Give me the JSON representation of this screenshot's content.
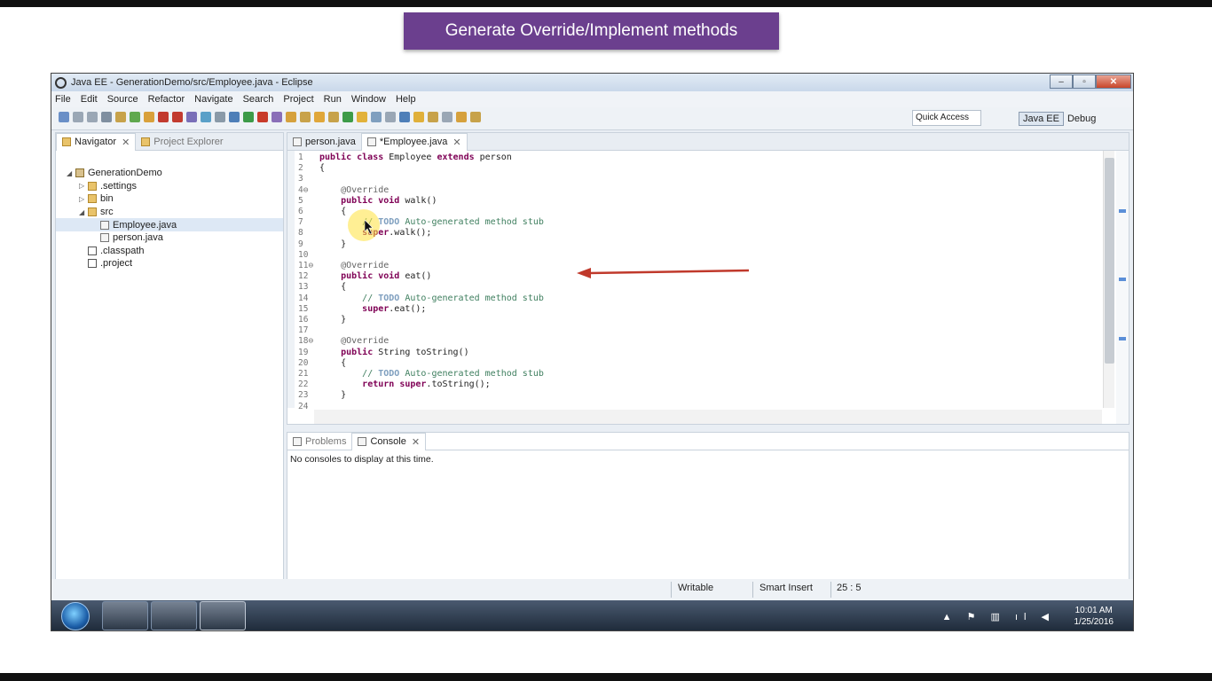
{
  "banner": {
    "text": "Generate Override/Implement methods"
  },
  "window": {
    "title": "Java EE - GenerationDemo/src/Employee.java - Eclipse",
    "controls": {
      "minimize": "–",
      "maximize": "▫",
      "close": "✕"
    }
  },
  "menu": [
    "File",
    "Edit",
    "Source",
    "Refactor",
    "Navigate",
    "Search",
    "Project",
    "Run",
    "Window",
    "Help"
  ],
  "toolbar": {
    "quick_access": "Quick Access",
    "perspectives": [
      "Java EE",
      "Debug"
    ]
  },
  "left_panel": {
    "tabs": [
      "Navigator",
      "Project Explorer"
    ],
    "tree": [
      {
        "label": "GenerationDemo",
        "depth": 0,
        "arrow": "◢",
        "icon": "proj"
      },
      {
        "label": ".settings",
        "depth": 1,
        "arrow": "▷",
        "icon": "folder"
      },
      {
        "label": "bin",
        "depth": 1,
        "arrow": "▷",
        "icon": "folder"
      },
      {
        "label": "src",
        "depth": 1,
        "arrow": "◢",
        "icon": "folder"
      },
      {
        "label": "Employee.java",
        "depth": 2,
        "arrow": "",
        "icon": "java",
        "selected": true
      },
      {
        "label": "person.java",
        "depth": 2,
        "arrow": "",
        "icon": "java"
      },
      {
        "label": ".classpath",
        "depth": 1,
        "arrow": "",
        "icon": "xfile"
      },
      {
        "label": ".project",
        "depth": 1,
        "arrow": "",
        "icon": "xfile"
      }
    ]
  },
  "editor": {
    "tabs": [
      {
        "label": "person.java",
        "active": false
      },
      {
        "label": "*Employee.java",
        "active": true
      }
    ],
    "lines": [
      {
        "n": "1",
        "html": "<span class='kw'>public class</span> Employee <span class='kw'>extends</span> person"
      },
      {
        "n": "2",
        "html": "{"
      },
      {
        "n": "3",
        "html": ""
      },
      {
        "n": "4⊖",
        "html": "    <span class='ann'>@Override</span>"
      },
      {
        "n": "5",
        "html": "    <span class='kw'>public void</span> walk()"
      },
      {
        "n": "6",
        "html": "    {"
      },
      {
        "n": "7",
        "html": "        <span class='cm'>// <span class='todo'>TODO</span> Auto-generated method stub</span>"
      },
      {
        "n": "8",
        "html": "        <span class='kw'>super</span>.walk();"
      },
      {
        "n": "9",
        "html": "    }"
      },
      {
        "n": "10",
        "html": ""
      },
      {
        "n": "11⊖",
        "html": "    <span class='ann'>@Override</span>"
      },
      {
        "n": "12",
        "html": "    <span class='kw'>public void</span> eat()"
      },
      {
        "n": "13",
        "html": "    {"
      },
      {
        "n": "14",
        "html": "        <span class='cm'>// <span class='todo'>TODO</span> Auto-generated method stub</span>"
      },
      {
        "n": "15",
        "html": "        <span class='kw'>super</span>.eat();"
      },
      {
        "n": "16",
        "html": "    }"
      },
      {
        "n": "17",
        "html": ""
      },
      {
        "n": "18⊖",
        "html": "    <span class='ann'>@Override</span>"
      },
      {
        "n": "19",
        "html": "    <span class='kw'>public</span> String toString()"
      },
      {
        "n": "20",
        "html": "    {"
      },
      {
        "n": "21",
        "html": "        <span class='cm'>// <span class='todo'>TODO</span> Auto-generated method stub</span>"
      },
      {
        "n": "22",
        "html": "        <span class='kw'>return super</span>.toString();"
      },
      {
        "n": "23",
        "html": "    }"
      },
      {
        "n": "24",
        "html": ""
      }
    ]
  },
  "bottom_panel": {
    "tabs": [
      {
        "label": "Problems",
        "active": false
      },
      {
        "label": "Console",
        "active": true
      }
    ],
    "message": "No consoles to display at this time."
  },
  "status_bar": {
    "writable": "Writable",
    "insert_mode": "Smart Insert",
    "position": "25 : 5"
  },
  "taskbar": {
    "time": "10:01 AM",
    "date": "1/25/2016"
  }
}
